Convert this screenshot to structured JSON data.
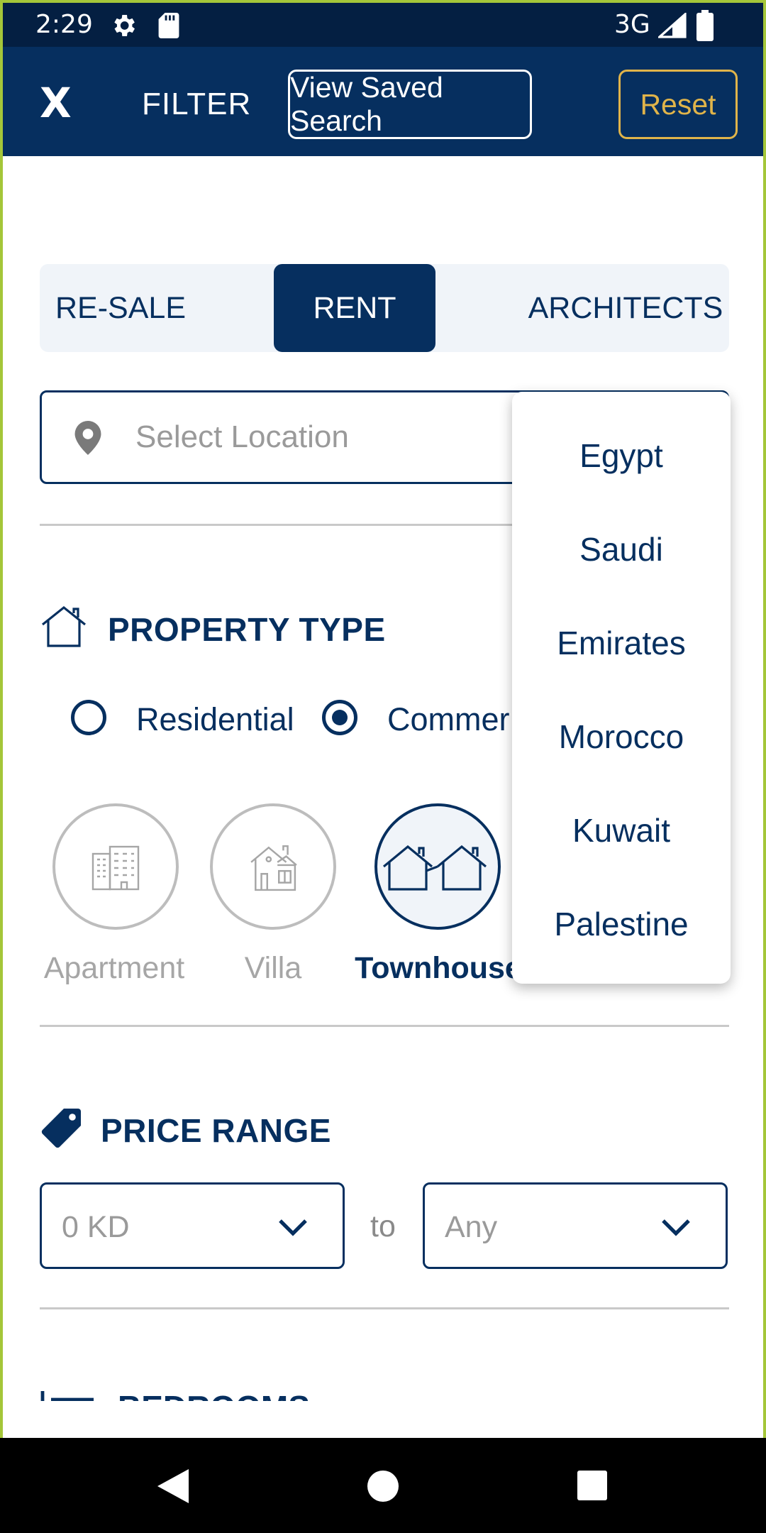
{
  "status_bar": {
    "time": "2:29",
    "network": "3G",
    "icons": [
      "gear-icon",
      "sd-card-icon",
      "signal-icon",
      "battery-icon"
    ]
  },
  "app_bar": {
    "close_label": "X",
    "title": "FILTER",
    "saved_search_label": "View Saved Search",
    "reset_label": "Reset"
  },
  "tabs": [
    {
      "label": "RE-SALE",
      "selected": false
    },
    {
      "label": "RENT",
      "selected": true
    },
    {
      "label": "ARCHITECTS",
      "selected": false
    }
  ],
  "location": {
    "placeholder": "Select Location",
    "value": ""
  },
  "location_dropdown": {
    "options": [
      "Egypt",
      "Saudi",
      "Emirates",
      "Morocco",
      "Kuwait",
      "Palestine"
    ]
  },
  "property_type": {
    "title": "PROPERTY TYPE",
    "categories": [
      {
        "label": "Residential",
        "checked": false
      },
      {
        "label": "Commer",
        "checked": true
      }
    ],
    "types": [
      {
        "label": "Apartment",
        "icon": "apartment-building-icon",
        "selected": false
      },
      {
        "label": "Villa",
        "icon": "villa-icon",
        "selected": false
      },
      {
        "label": "Townhouse",
        "icon": "townhouse-icon",
        "selected": true
      }
    ]
  },
  "price_range": {
    "title": "PRICE RANGE",
    "min_value": "0 KD",
    "separator": "to",
    "max_value": "Any"
  },
  "bedrooms": {
    "title": "BEDROOMS"
  },
  "colors": {
    "primary": "#062f5f",
    "status_bar": "#041f42",
    "accent_gold": "#e0b44a",
    "tab_background": "#f0f4f9",
    "muted_gray": "#a6a6a6"
  }
}
